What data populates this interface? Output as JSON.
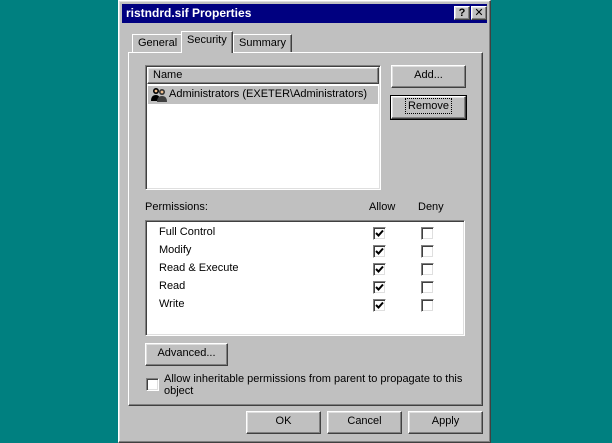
{
  "window": {
    "title": "ristndrd.sif Properties",
    "help_glyph": "?",
    "close_glyph": "✕"
  },
  "tabs": [
    {
      "label": "General",
      "active": false
    },
    {
      "label": "Security",
      "active": true
    },
    {
      "label": "Summary",
      "active": false
    }
  ],
  "name_list": {
    "header": "Name",
    "entries": [
      {
        "label": "Administrators (EXETER\\Administrators)",
        "icon": "group-users-icon",
        "selected": true
      }
    ]
  },
  "buttons": {
    "add": "Add...",
    "remove": "Remove",
    "advanced": "Advanced...",
    "ok": "OK",
    "cancel": "Cancel",
    "apply": "Apply"
  },
  "permissions": {
    "label": "Permissions:",
    "allow_header": "Allow",
    "deny_header": "Deny",
    "rows": [
      {
        "name": "Full Control",
        "allow": true,
        "deny": false
      },
      {
        "name": "Modify",
        "allow": true,
        "deny": false
      },
      {
        "name": "Read & Execute",
        "allow": true,
        "deny": false
      },
      {
        "name": "Read",
        "allow": true,
        "deny": false
      },
      {
        "name": "Write",
        "allow": true,
        "deny": false
      }
    ]
  },
  "inherit": {
    "label_line1": "Allow inheritable permissions from parent to propagate to this",
    "label_line2": "object",
    "checked": false
  },
  "colors": {
    "desktop": "#008080",
    "titlebar": "#000080",
    "face": "#c0c0c0",
    "selection": "#c0c0c0"
  }
}
